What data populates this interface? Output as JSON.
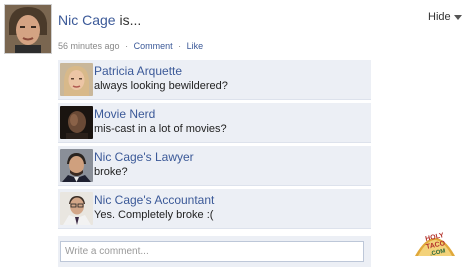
{
  "post": {
    "author": "Nic Cage",
    "verb": "is...",
    "hide_label": "Hide",
    "time": "56 minutes ago",
    "separator": "·",
    "comment_link": "Comment",
    "like_link": "Like"
  },
  "comments": [
    {
      "name": "Patricia Arquette",
      "text": "always looking bewildered?"
    },
    {
      "name": "Movie Nerd",
      "text": "mis-cast in a lot of movies?"
    },
    {
      "name": "Nic Cage's Lawyer",
      "text": "broke?"
    },
    {
      "name": "Nic Cage's Accountant",
      "text": "Yes. Completely broke :("
    }
  ],
  "reply": {
    "placeholder": "Write a comment..."
  },
  "watermark": {
    "line1": "HOLY",
    "line2": "TACO",
    "line3": ".COM"
  },
  "colors": {
    "link": "#3b5998",
    "comment_bg": "#eceff5",
    "input_border": "#bdc7d8"
  }
}
